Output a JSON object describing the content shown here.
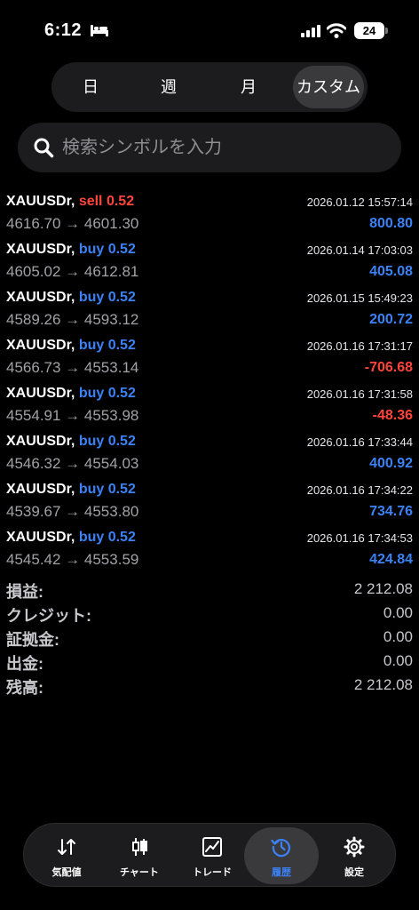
{
  "status": {
    "time": "6:12",
    "battery": "24"
  },
  "segments": [
    {
      "label": "日"
    },
    {
      "label": "週"
    },
    {
      "label": "月"
    },
    {
      "label": "カスタム"
    }
  ],
  "search": {
    "placeholder": "検索シンボルを入力"
  },
  "trades": [
    {
      "symbol": "XAUUSDr,",
      "side": "sell 0.52",
      "date": "2026.01.12 15:57:14",
      "prices": "4616.70 → 4601.30",
      "profit": "800.80"
    },
    {
      "symbol": "XAUUSDr,",
      "side": "buy 0.52",
      "date": "2026.01.14 17:03:03",
      "prices": "4605.02 → 4612.81",
      "profit": "405.08"
    },
    {
      "symbol": "XAUUSDr,",
      "side": "buy 0.52",
      "date": "2026.01.15 15:49:23",
      "prices": "4589.26 → 4593.12",
      "profit": "200.72"
    },
    {
      "symbol": "XAUUSDr,",
      "side": "buy 0.52",
      "date": "2026.01.16 17:31:17",
      "prices": "4566.73 → 4553.14",
      "profit": "-706.68"
    },
    {
      "symbol": "XAUUSDr,",
      "side": "buy 0.52",
      "date": "2026.01.16 17:31:58",
      "prices": "4554.91 → 4553.98",
      "profit": "-48.36"
    },
    {
      "symbol": "XAUUSDr,",
      "side": "buy 0.52",
      "date": "2026.01.16 17:33:44",
      "prices": "4546.32 → 4554.03",
      "profit": "400.92"
    },
    {
      "symbol": "XAUUSDr,",
      "side": "buy 0.52",
      "date": "2026.01.16 17:34:22",
      "prices": "4539.67 → 4553.80",
      "profit": "734.76"
    },
    {
      "symbol": "XAUUSDr,",
      "side": "buy 0.52",
      "date": "2026.01.16 17:34:53",
      "prices": "4545.42 → 4553.59",
      "profit": "424.84"
    }
  ],
  "summary": [
    {
      "label": "損益:",
      "value": "2 212.08"
    },
    {
      "label": "クレジット:",
      "value": "0.00"
    },
    {
      "label": "証拠金:",
      "value": "0.00"
    },
    {
      "label": "出金:",
      "value": "0.00"
    },
    {
      "label": "残高:",
      "value": "2 212.08"
    }
  ],
  "tabs": [
    {
      "label": "気配値",
      "icon": "quotes-arrows-icon"
    },
    {
      "label": "チャート",
      "icon": "candlestick-icon"
    },
    {
      "label": "トレード",
      "icon": "trade-chart-icon"
    },
    {
      "label": "履歴",
      "icon": "history-clock-icon"
    },
    {
      "label": "設定",
      "icon": "gear-icon"
    }
  ],
  "colors": {
    "sell": "#ff453a",
    "buy": "#3b82f6",
    "loss": "#ff453a",
    "profit": "#3b82f6",
    "active_tab": "#3b82f6"
  }
}
